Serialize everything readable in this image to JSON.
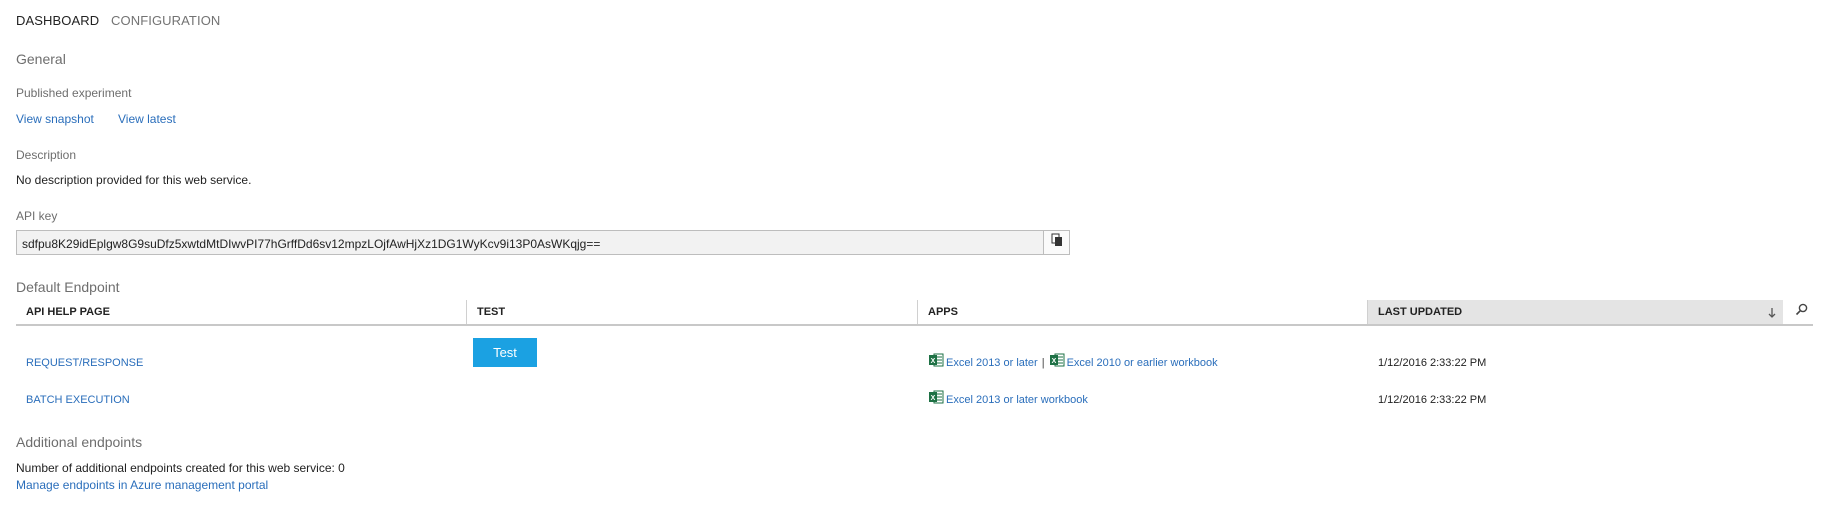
{
  "tabs": [
    {
      "label": "DASHBOARD",
      "active": true
    },
    {
      "label": "CONFIGURATION",
      "active": false
    }
  ],
  "general": {
    "heading": "General",
    "published_label": "Published experiment",
    "view_snapshot": "View snapshot",
    "view_latest": "View latest",
    "description_label": "Description",
    "description_value": "No description provided for this web service.",
    "api_key_label": "API key",
    "api_key_value": "sdfpu8K29idEplgw8G9suDfz5xwtdMtDIwvPI77hGrffDd6sv12mpzLOjfAwHjXz1DG1WyKcv9i13P0AsWKqjg=="
  },
  "default_endpoint": {
    "heading": "Default Endpoint",
    "columns": [
      "API HELP PAGE",
      "TEST",
      "APPS",
      "LAST UPDATED"
    ],
    "rows": [
      {
        "help_page": "REQUEST/RESPONSE",
        "test_label": "Test",
        "apps": [
          "Excel 2013 or later",
          "Excel 2010 or earlier workbook"
        ],
        "apps_separator": "|",
        "last_updated": "1/12/2016 2:33:22 PM"
      },
      {
        "help_page": "BATCH EXECUTION",
        "apps": [
          "Excel 2013 or later workbook"
        ],
        "last_updated": "1/12/2016 2:33:22 PM"
      }
    ]
  },
  "additional": {
    "heading": "Additional endpoints",
    "count_text": "Number of additional endpoints created for this web service: 0",
    "manage_link": "Manage endpoints in Azure management portal"
  },
  "icons": {
    "copy": "copy-icon",
    "sort": "sort-down-arrow-icon",
    "search": "search-icon",
    "excel": "excel-icon"
  },
  "colors": {
    "link": "#2a6ebb",
    "button": "#1ba1e2",
    "excel_green": "#1e7145"
  }
}
